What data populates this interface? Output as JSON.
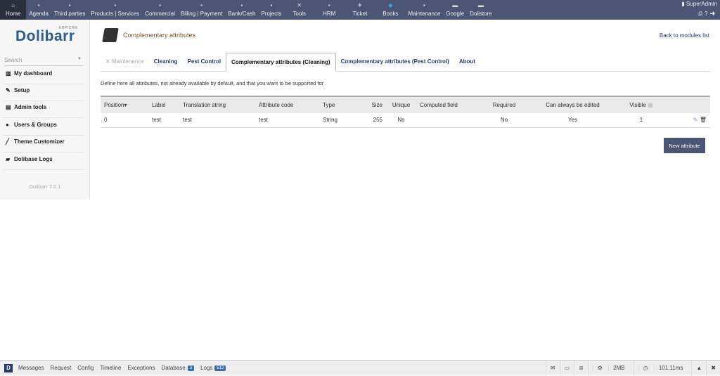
{
  "topmenu": [
    {
      "label": "Home",
      "icon": "home-icon",
      "active": true
    },
    {
      "label": "Agenda",
      "icon": "agenda-icon"
    },
    {
      "label": "Third parties",
      "icon": "company-icon"
    },
    {
      "label": "Products | Services",
      "icon": "products-icon"
    },
    {
      "label": "Commercial",
      "icon": "commercial-icon"
    },
    {
      "label": "Billing | Payment",
      "icon": "billing-icon"
    },
    {
      "label": "Bank/Cash",
      "icon": "bank-icon"
    },
    {
      "label": "Projects",
      "icon": "projects-icon"
    },
    {
      "label": "Tools",
      "icon": "tools-icon"
    },
    {
      "label": "HRM",
      "icon": "hrm-icon"
    },
    {
      "label": "Ticket",
      "icon": "ticket-icon"
    },
    {
      "label": "Books",
      "icon": "books-icon"
    },
    {
      "label": "Maintenance",
      "icon": "maintenance-icon"
    },
    {
      "label": "Google",
      "icon": "google-icon"
    },
    {
      "label": "Dolistore",
      "icon": "dolistore-icon"
    }
  ],
  "user": {
    "name": "SuperAdmin"
  },
  "sidebar": {
    "logo": "Dolibarr",
    "logo_sub": "ERP/CRM",
    "search_placeholder": "Search",
    "items": [
      {
        "label": "My dashboard"
      },
      {
        "label": "Setup"
      },
      {
        "label": "Admin tools"
      },
      {
        "label": "Users & Groups"
      },
      {
        "label": "Theme Customizer"
      },
      {
        "label": "Dolibase Logs"
      }
    ],
    "version": "Dolibarr 7.0.1"
  },
  "main": {
    "title": "Complementary attributes",
    "back_link": "Back to modules list",
    "tabs": [
      {
        "label": "Maintenance"
      },
      {
        "label": "Cleaning"
      },
      {
        "label": "Pest Control"
      },
      {
        "label": "Complementary attributes (Cleaning)"
      },
      {
        "label": "Complementary attributes (Pest Control)"
      },
      {
        "label": "About"
      }
    ],
    "description": "Define here all attributes, not already available by default, and that you want to be supported for .",
    "table": {
      "headers": [
        "Position",
        "Label",
        "Translation string",
        "Attribute code",
        "Type",
        "Size",
        "Unique",
        "Computed field",
        "Required",
        "Can always be edited",
        "Visible"
      ],
      "rows": [
        [
          "0",
          "test",
          "test",
          "test",
          "String",
          "255",
          "No",
          "",
          "No",
          "Yes",
          "1"
        ]
      ]
    },
    "new_button": "New attribute"
  },
  "debugbar": {
    "items": [
      "Messages",
      "Request",
      "Config",
      "Timeline",
      "Exceptions",
      "Database",
      "Logs"
    ],
    "database_count": "3",
    "logs_count": "512",
    "memory": "2MB",
    "time": "101.11ms"
  },
  "colors": {
    "topbar": "#4d5575",
    "link": "#263c82"
  }
}
